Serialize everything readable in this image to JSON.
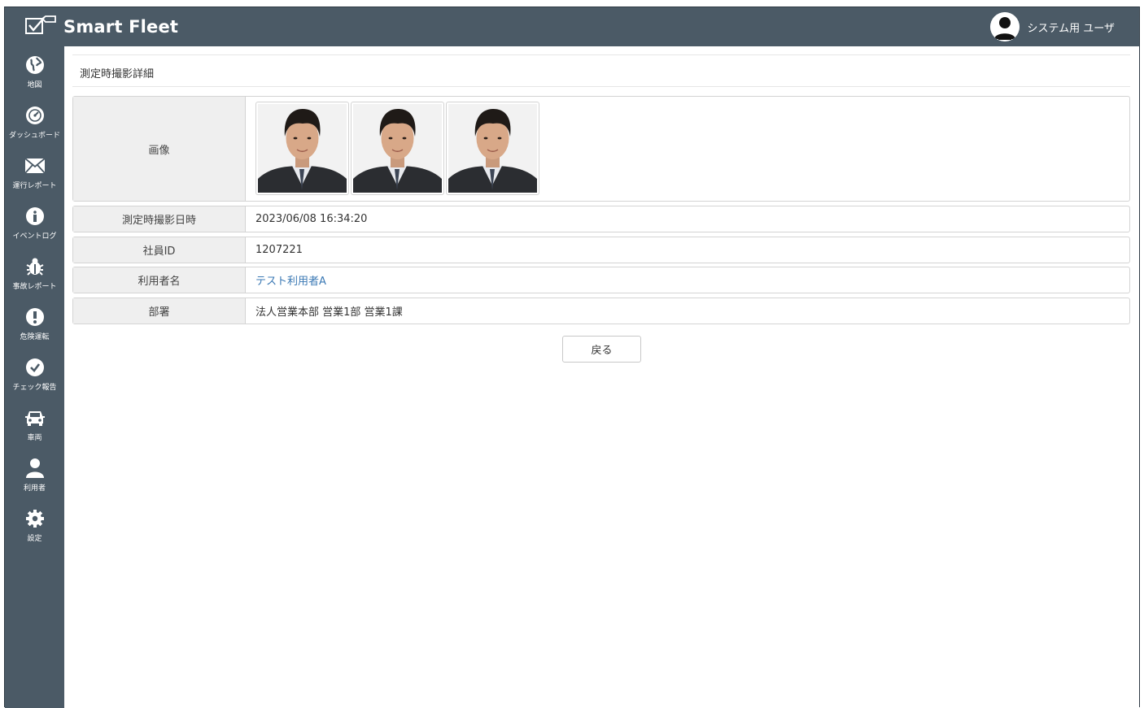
{
  "app": {
    "brand_name": "Smart Fleet",
    "user_name": "システム用 ユーザ"
  },
  "sidebar": {
    "items": [
      {
        "label": "地図",
        "icon": "globe-icon"
      },
      {
        "label": "ダッシュボード",
        "icon": "gauge-icon"
      },
      {
        "label": "運行レポート",
        "icon": "envelope-icon"
      },
      {
        "label": "イベントログ",
        "icon": "info-icon"
      },
      {
        "label": "事故レポート",
        "icon": "bug-icon"
      },
      {
        "label": "危険運転",
        "icon": "exclamation-icon"
      },
      {
        "label": "チェック報告",
        "icon": "check-circle-icon"
      },
      {
        "label": "車両",
        "icon": "car-icon"
      },
      {
        "label": "利用者",
        "icon": "user-icon"
      },
      {
        "label": "設定",
        "icon": "gear-icon"
      }
    ]
  },
  "page": {
    "title": "測定時撮影詳細",
    "fields": {
      "image_label": "画像",
      "datetime_label": "測定時撮影日時",
      "datetime_value": "2023/06/08 16:34:20",
      "employee_id_label": "社員ID",
      "employee_id_value": "1207221",
      "user_name_label": "利用者名",
      "user_name_value": "テスト利用者A",
      "department_label": "部署",
      "department_value": "法人営業本部 営業1部 営業1課"
    },
    "photos_count": 3,
    "back_button_label": "戻る"
  },
  "colors": {
    "header_bg": "#4b5a66",
    "link": "#3a78b4",
    "label_bg": "#efefef"
  }
}
